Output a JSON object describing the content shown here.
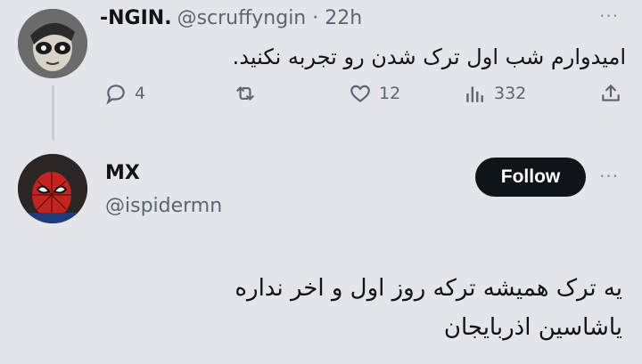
{
  "tweet1": {
    "display_name": "-NGIN.",
    "handle_time": "@scruffyngin · 22h",
    "text": "امیدوارم شب اول ترک شدن رو تجربه نکنید.",
    "actions": {
      "replies": "4",
      "likes": "12",
      "views": "332"
    }
  },
  "tweet2": {
    "display_name": "MX",
    "handle": "@ispidermn",
    "follow_label": "Follow",
    "text_line1": "یه ترک همیشه ترکه روز اول و اخر نداره",
    "text_line2": "یاشاسین اذربایجان"
  },
  "icons": {
    "reply": "reply-icon",
    "retweet": "retweet-icon",
    "like": "heart-icon",
    "views": "views-icon",
    "share": "share-icon",
    "more": "more-icon"
  },
  "colors": {
    "background": "#e4e5ea",
    "text": "#0f1419",
    "muted": "#5b6570",
    "follow_button": "#0f1419"
  }
}
